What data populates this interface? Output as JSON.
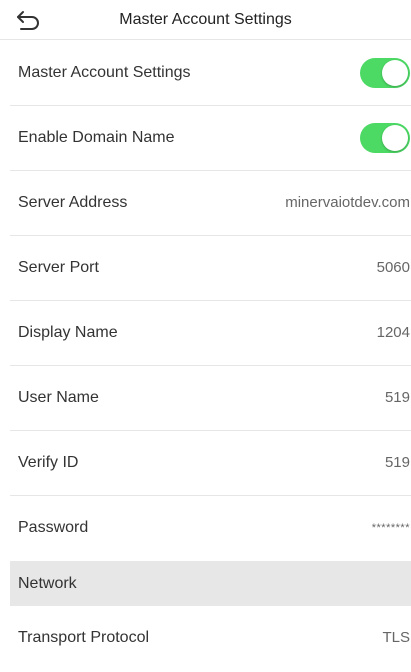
{
  "header": {
    "title": "Master Account Settings",
    "back_icon": "back-arrow-icon"
  },
  "rows": [
    {
      "label": "Master Account Settings",
      "type": "toggle",
      "on": true
    },
    {
      "label": "Enable Domain Name",
      "type": "toggle",
      "on": true
    },
    {
      "label": "Server Address",
      "type": "value",
      "value": "minervaiotdev.com"
    },
    {
      "label": "Server Port",
      "type": "value",
      "value": "5060"
    },
    {
      "label": "Display Name",
      "type": "value",
      "value": "1204"
    },
    {
      "label": "User Name",
      "type": "value",
      "value": "519"
    },
    {
      "label": "Verify ID",
      "type": "value",
      "value": "519"
    },
    {
      "label": "Password",
      "type": "value",
      "value": "********"
    }
  ],
  "section": {
    "label": "Network"
  },
  "network_rows": [
    {
      "label": "Transport Protocol",
      "type": "value",
      "value": "TLS"
    }
  ],
  "colors": {
    "toggle_on": "#4cd964",
    "divider": "#e6e6e6",
    "section_bg": "#e7e7e7"
  }
}
